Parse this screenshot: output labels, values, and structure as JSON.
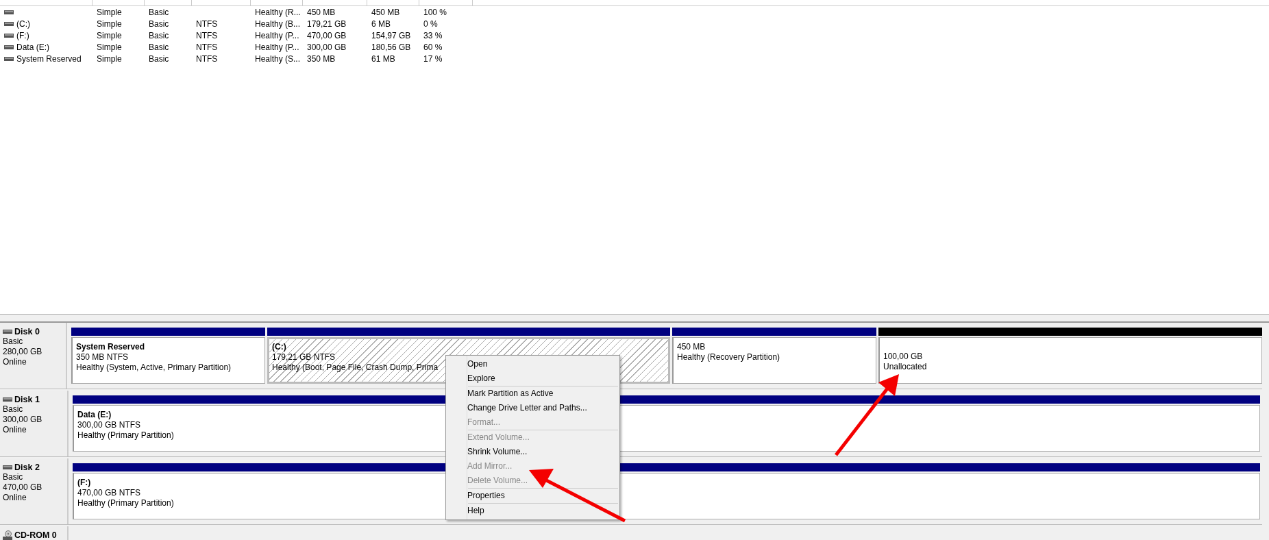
{
  "volumes": {
    "rows": [
      {
        "volume": "",
        "layout": "Simple",
        "type": "Basic",
        "file_system": "",
        "status": "Healthy (R...",
        "capacity": "450 MB",
        "free_space": "450 MB",
        "percent_free": "100 %"
      },
      {
        "volume": "(C:)",
        "layout": "Simple",
        "type": "Basic",
        "file_system": "NTFS",
        "status": "Healthy (B...",
        "capacity": "179,21 GB",
        "free_space": "6 MB",
        "percent_free": "0 %"
      },
      {
        "volume": "(F:)",
        "layout": "Simple",
        "type": "Basic",
        "file_system": "NTFS",
        "status": "Healthy (P...",
        "capacity": "470,00 GB",
        "free_space": "154,97 GB",
        "percent_free": "33 %"
      },
      {
        "volume": "Data (E:)",
        "layout": "Simple",
        "type": "Basic",
        "file_system": "NTFS",
        "status": "Healthy (P...",
        "capacity": "300,00 GB",
        "free_space": "180,56 GB",
        "percent_free": "60 %"
      },
      {
        "volume": "System Reserved",
        "layout": "Simple",
        "type": "Basic",
        "file_system": "NTFS",
        "status": "Healthy (S...",
        "capacity": "350 MB",
        "free_space": "61 MB",
        "percent_free": "17 %"
      }
    ]
  },
  "disks": [
    {
      "kind": "disk",
      "name": "Disk 0",
      "type": "Basic",
      "size": "280,00 GB",
      "state": "Online",
      "partitions": [
        {
          "kind": "primary",
          "name": "System Reserved",
          "size": "350 MB NTFS",
          "status": "Healthy (System, Active, Primary Partition)",
          "selected": false
        },
        {
          "kind": "primary",
          "name": "(C:)",
          "size": "179,21 GB NTFS",
          "status": "Healthy (Boot, Page File, Crash Dump, Prima",
          "selected": true
        },
        {
          "kind": "primary",
          "size": "450 MB",
          "status": "Healthy (Recovery Partition)",
          "selected": false
        },
        {
          "kind": "unallocated",
          "size": "100,00 GB",
          "status": "Unallocated",
          "selected": false
        }
      ]
    },
    {
      "kind": "disk",
      "name": "Disk 1",
      "type": "Basic",
      "size": "300,00 GB",
      "state": "Online",
      "partitions": [
        {
          "kind": "primary",
          "name": "Data  (E:)",
          "size": "300,00 GB NTFS",
          "status": "Healthy (Primary Partition)",
          "selected": false
        }
      ]
    },
    {
      "kind": "disk",
      "name": "Disk 2",
      "type": "Basic",
      "size": "470,00 GB",
      "state": "Online",
      "partitions": [
        {
          "kind": "primary",
          "name": "(F:)",
          "size": "470,00 GB NTFS",
          "status": "Healthy (Primary Partition)",
          "selected": false
        }
      ]
    },
    {
      "kind": "cdrom",
      "name": "CD-ROM 0"
    }
  ],
  "context_menu": {
    "groups": [
      [
        {
          "label": "Open",
          "disabled": false
        },
        {
          "label": "Explore",
          "disabled": false
        }
      ],
      [
        {
          "label": "Mark Partition as Active",
          "disabled": false
        },
        {
          "label": "Change Drive Letter and Paths...",
          "disabled": false
        },
        {
          "label": "Format...",
          "disabled": true
        }
      ],
      [
        {
          "label": "Extend Volume...",
          "disabled": true
        },
        {
          "label": "Shrink Volume...",
          "disabled": false
        },
        {
          "label": "Add Mirror...",
          "disabled": true
        },
        {
          "label": "Delete Volume...",
          "disabled": true
        }
      ],
      [
        {
          "label": "Properties",
          "disabled": false
        }
      ],
      [
        {
          "label": "Help",
          "disabled": false
        }
      ]
    ]
  }
}
